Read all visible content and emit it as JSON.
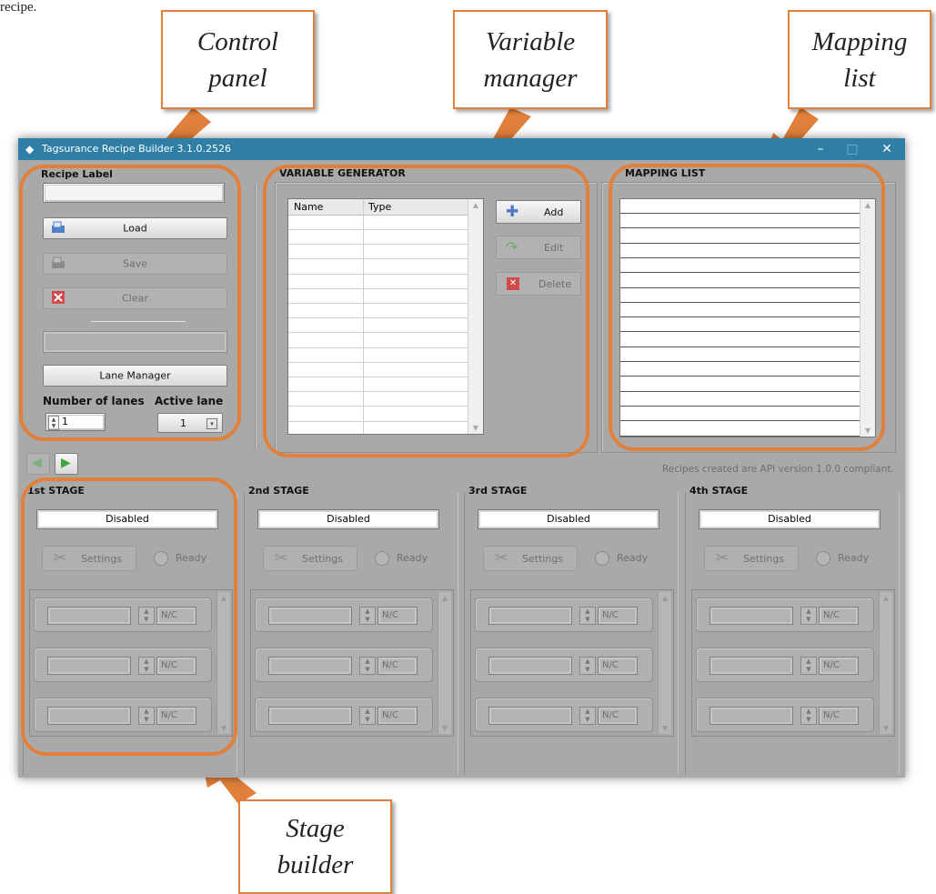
{
  "caption_fragment": "recipe.",
  "callouts": {
    "control_panel": "Control panel",
    "variable_manager": "Variable manager",
    "mapping_list": "Mapping list",
    "stage_builder": "Stage builder"
  },
  "window": {
    "title": "Tagsurance Recipe Builder 3.1.0.2526",
    "minimize": "–",
    "maximize": "□",
    "close": "✕"
  },
  "control_panel": {
    "recipe_label": "Recipe Label",
    "recipe_value": "",
    "load": "Load",
    "save": "Save",
    "clear": "Clear",
    "lane_manager": "Lane Manager",
    "number_of_lanes_label": "Number of lanes",
    "number_of_lanes_value": "1",
    "active_lane_label": "Active lane",
    "active_lane_value": "1"
  },
  "variable_generator": {
    "title": "VARIABLE GENERATOR",
    "columns": [
      "Name",
      "Type"
    ],
    "add": "Add",
    "edit": "Edit",
    "delete": "Delete"
  },
  "mapping_list": {
    "title": "MAPPING LIST"
  },
  "api_note": "Recipes created are API version 1.0.0 compliant.",
  "stages": [
    {
      "title": "1st STAGE",
      "status": "Disabled",
      "settings": "Settings",
      "ready": "Ready",
      "slots": [
        "N/C",
        "N/C",
        "N/C"
      ]
    },
    {
      "title": "2nd STAGE",
      "status": "Disabled",
      "settings": "Settings",
      "ready": "Ready",
      "slots": [
        "N/C",
        "N/C",
        "N/C"
      ]
    },
    {
      "title": "3rd STAGE",
      "status": "Disabled",
      "settings": "Settings",
      "ready": "Ready",
      "slots": [
        "N/C",
        "N/C",
        "N/C"
      ]
    },
    {
      "title": "4th STAGE",
      "status": "Disabled",
      "settings": "Settings",
      "ready": "Ready",
      "slots": [
        "N/C",
        "N/C",
        "N/C"
      ]
    }
  ],
  "colors": {
    "highlight": "#e0803a",
    "titlebar": "#2e7ea5",
    "window_bg": "#a9a9a9"
  }
}
